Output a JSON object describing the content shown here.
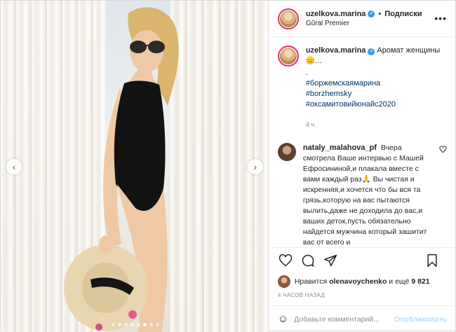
{
  "post": {
    "username": "uzelkova.marina",
    "follow_label": "Подписки",
    "separator": "•",
    "location": "Gŭral Premier",
    "more_icon": "more-dots-icon",
    "verified_mark": "✓"
  },
  "caption": {
    "username": "uzelkova.marina",
    "text": "Аромат женщины😑...",
    "dot": ".",
    "hashtags": [
      "#боржемскаямарина",
      "#borzhemsky",
      "#оксамитовийюнайс2020"
    ],
    "time": "4 ч."
  },
  "comment": {
    "username": "nataly_malahova_pf",
    "text": "Вчера смотрела Ваше интервью с Машей Ефросининой,и плакала вместе с вами каждый раз🙏 Вы чистая и искренняя,и хочется что бы вся та грязь,которую на вас пытаются вылить,даже не доходила до вас,и ваших деток,пусть обязательно найдется мужчина который зашитит вас от всего и"
  },
  "likes": {
    "prefix": "Нравится",
    "user": "olenavoychenko",
    "middle": "и ещё",
    "count": "9 821"
  },
  "post_time": "4 ЧАСОВ НАЗАД",
  "add_comment": {
    "placeholder": "Добавьте комментарий...",
    "publish": "Опубликовать"
  },
  "carousel": {
    "prev": "‹",
    "next": "›",
    "dots_total": 8,
    "active_index": 5
  },
  "colors": {
    "accent": "#3897f0",
    "hashtag": "#00376b",
    "publish_disabled": "#b2dffc",
    "muted": "#8e8e8e"
  }
}
